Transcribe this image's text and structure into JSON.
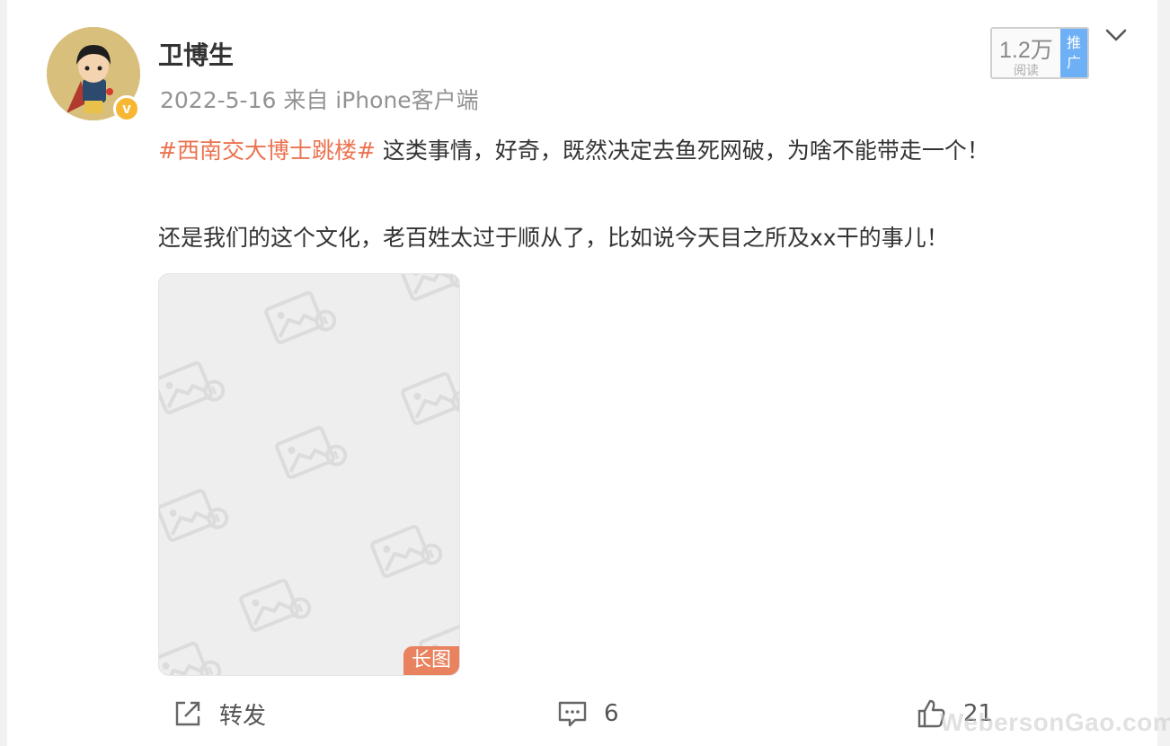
{
  "post": {
    "author": "卫博生",
    "date": "2022-5-16",
    "source": "来自 iPhone客户端",
    "reads": {
      "count": "1.2万",
      "label": "阅读",
      "promo": "推广"
    },
    "hashtag": "#西南交大博士跳楼#",
    "line1_rest": " 这类事情，好奇，既然决定去鱼死网破，为啥不能带走一个！",
    "line2": "还是我们的这个文化，老百姓太过于顺从了，比如说今天目之所及xx干的事儿！",
    "image_badge": "长图"
  },
  "actions": {
    "repost": "转发",
    "comments": "6",
    "likes": "21"
  },
  "watermark": "WebersonGao.com",
  "icons": [
    "verified-icon",
    "chevron-down-icon",
    "image-placeholder-icon",
    "repost-icon",
    "comment-icon",
    "like-icon"
  ],
  "colors": {
    "hashtag": "#eb7350",
    "verified": "#f7b733",
    "promo": "#6eb0f5",
    "badge": "#e8825f"
  }
}
